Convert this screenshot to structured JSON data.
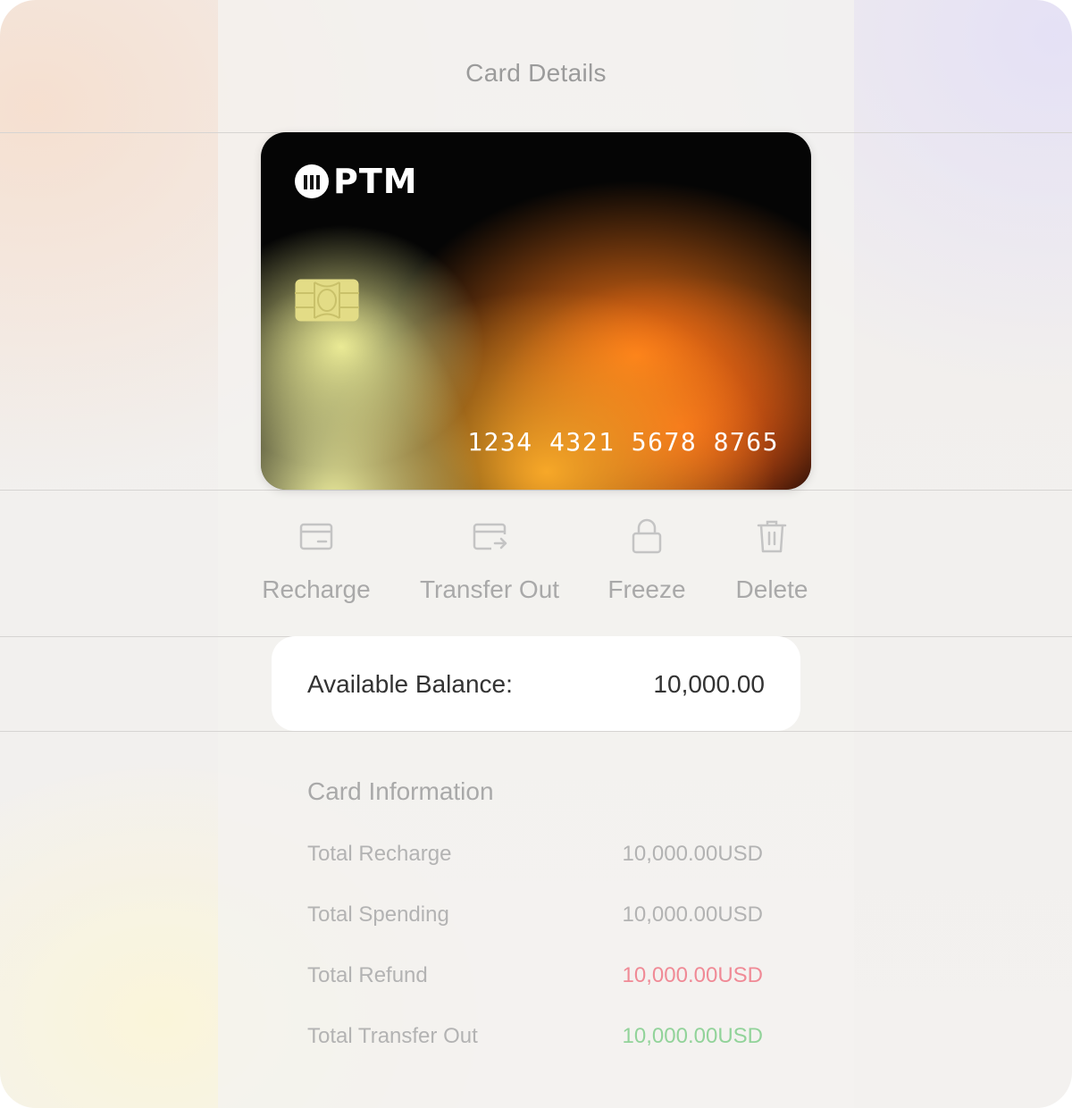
{
  "header": {
    "title": "Card Details"
  },
  "card": {
    "brand": "PTM",
    "number": "1234 4321 5678 8765",
    "logo_icon": "ptm-logo-icon",
    "chip_icon": "card-chip-icon"
  },
  "actions": [
    {
      "label": "Recharge",
      "icon": "wallet-icon"
    },
    {
      "label": "Transfer Out",
      "icon": "wallet-transfer-icon"
    },
    {
      "label": "Freeze",
      "icon": "lock-icon"
    },
    {
      "label": "Delete",
      "icon": "trash-icon"
    }
  ],
  "balance": {
    "label": "Available Balance:",
    "value": "10,000.00"
  },
  "card_info": {
    "title": "Card Information",
    "rows": [
      {
        "label": "Total Recharge",
        "value": "10,000.00USD",
        "color": "#b3b3b3"
      },
      {
        "label": "Total Spending",
        "value": "10,000.00USD",
        "color": "#b3b3b3"
      },
      {
        "label": "Total Refund",
        "value": "10,000.00USD",
        "color": "#f08a96"
      },
      {
        "label": "Total Transfer Out",
        "value": "10,000.00USD",
        "color": "#92d39a"
      }
    ]
  }
}
